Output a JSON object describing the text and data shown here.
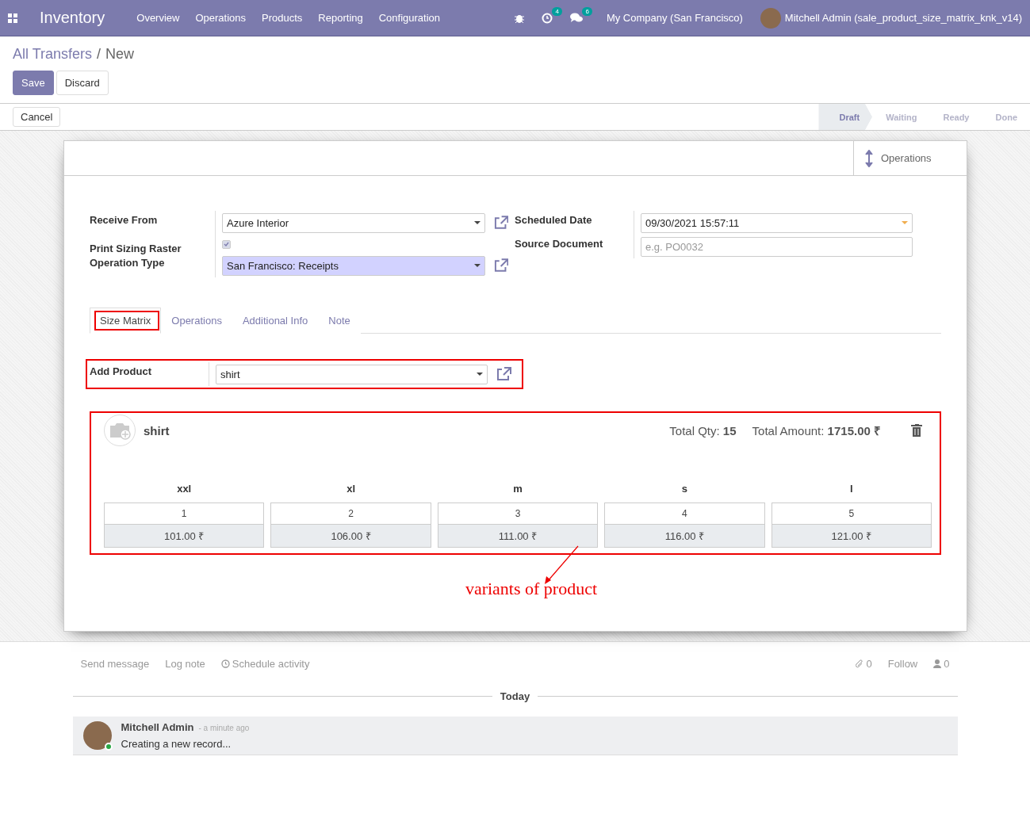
{
  "navbar": {
    "app_title": "Inventory",
    "menu": [
      "Overview",
      "Operations",
      "Products",
      "Reporting",
      "Configuration"
    ],
    "activity_count": "4",
    "message_count": "6",
    "company": "My Company (San Francisco)",
    "user": "Mitchell Admin (sale_product_size_matrix_knk_v14)"
  },
  "breadcrumb": {
    "parent": "All Transfers",
    "separator": "/",
    "current": "New"
  },
  "control_buttons": {
    "save": "Save",
    "discard": "Discard",
    "cancel": "Cancel"
  },
  "statusbar": [
    {
      "label": "Draft",
      "selected": true
    },
    {
      "label": "Waiting",
      "selected": false
    },
    {
      "label": "Ready",
      "selected": false
    },
    {
      "label": "Done",
      "selected": false
    }
  ],
  "button_box": {
    "label": "Operations"
  },
  "left_fields": [
    {
      "kind": "select",
      "label": "Receive From",
      "value": "Azure Interior",
      "highlighted": false,
      "external_link": true
    },
    {
      "kind": "checkbox",
      "label": "Print Sizing Raster",
      "checked": true
    },
    {
      "kind": "select",
      "label": "Operation Type",
      "value": "San Francisco: Receipts",
      "highlighted": true,
      "external_link": true
    }
  ],
  "right_fields": [
    {
      "kind": "date",
      "label": "Scheduled Date",
      "value": "09/30/2021 15:57:11"
    },
    {
      "kind": "text",
      "label": "Source Document",
      "placeholder": "e.g. PO0032"
    }
  ],
  "tabs": [
    {
      "label": "Size Matrix",
      "selected": true,
      "marked": true
    },
    {
      "label": "Operations",
      "selected": false,
      "marked": false
    },
    {
      "label": "Additional Info",
      "selected": false,
      "marked": false
    },
    {
      "label": "Note",
      "selected": false,
      "marked": false
    }
  ],
  "add_product": {
    "label": "Add Product",
    "value": "shirt",
    "marked": true
  },
  "matrix": {
    "product": "shirt",
    "total_qty_label": "Total Qty:",
    "total_qty": "15",
    "total_amount_label": "Total Amount:",
    "total_amount": "1715.00 ₹",
    "marked": true,
    "variants": [
      {
        "size": "xxl",
        "qty": "1",
        "price": "101.00 ₹"
      },
      {
        "size": "xl",
        "qty": "2",
        "price": "106.00 ₹"
      },
      {
        "size": "m",
        "qty": "3",
        "price": "111.00 ₹"
      },
      {
        "size": "s",
        "qty": "4",
        "price": "116.00 ₹"
      },
      {
        "size": "l",
        "qty": "5",
        "price": "121.00 ₹"
      }
    ]
  },
  "annotation": "variants of product",
  "chatter": {
    "actions": [
      "Send message",
      "Log note",
      "Schedule activity"
    ],
    "attachments": "0",
    "follow": "Follow",
    "followers": "0",
    "separator": "Today",
    "message": {
      "author": "Mitchell Admin",
      "time": "- a minute ago",
      "body": "Creating a new record...",
      "online": true
    }
  }
}
